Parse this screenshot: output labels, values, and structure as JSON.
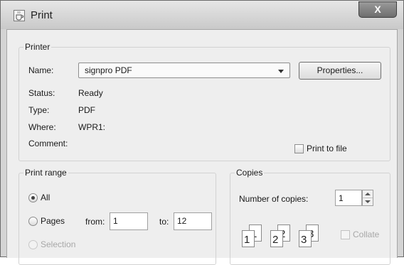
{
  "window": {
    "title": "Print",
    "close_label": "X",
    "icon": "java-coffee-cup-icon"
  },
  "printer": {
    "group_title": "Printer",
    "name_label": "Name:",
    "name_value": "signpro PDF",
    "properties_label": "Properties...",
    "status_label": "Status:",
    "status_value": "Ready",
    "type_label": "Type:",
    "type_value": "PDF",
    "where_label": "Where:",
    "where_value": "WPR1:",
    "comment_label": "Comment:",
    "print_to_file_label": "Print to file",
    "print_to_file_checked": false
  },
  "print_range": {
    "group_title": "Print range",
    "all_label": "All",
    "pages_label": "Pages",
    "from_label": "from:",
    "from_value": "1",
    "to_label": "to:",
    "to_value": "12",
    "selection_label": "Selection",
    "selected": "All"
  },
  "copies": {
    "group_title": "Copies",
    "number_label": "Number of copies:",
    "number_value": "1",
    "collate_label": "Collate",
    "collate_checked": false,
    "collate_pages": [
      "1",
      "1",
      "2",
      "2",
      "3",
      "3"
    ]
  }
}
